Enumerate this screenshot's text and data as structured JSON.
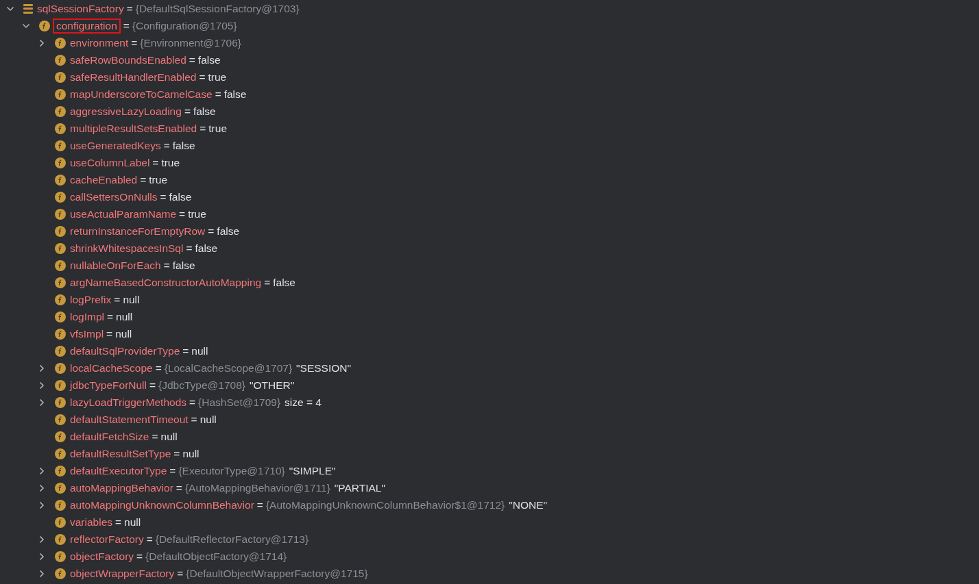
{
  "variables": [
    {
      "kind": "object",
      "name": "sqlSessionFactory",
      "eq": "=",
      "type": "{DefaultSqlSessionFactory@1703}",
      "expanded": true,
      "children": [
        {
          "kind": "field",
          "name": "configuration",
          "eq": "=",
          "type": "{Configuration@1705}",
          "expanded": true,
          "highlighted": true,
          "children": [
            {
              "kind": "field",
              "name": "environment",
              "eq": "=",
              "type": "{Environment@1706}",
              "expanded": false
            },
            {
              "kind": "field",
              "name": "safeRowBoundsEnabled",
              "eq": "=",
              "value": "false"
            },
            {
              "kind": "field",
              "name": "safeResultHandlerEnabled",
              "eq": "=",
              "value": "true"
            },
            {
              "kind": "field",
              "name": "mapUnderscoreToCamelCase",
              "eq": "=",
              "value": "false"
            },
            {
              "kind": "field",
              "name": "aggressiveLazyLoading",
              "eq": "=",
              "value": "false"
            },
            {
              "kind": "field",
              "name": "multipleResultSetsEnabled",
              "eq": "=",
              "value": "true"
            },
            {
              "kind": "field",
              "name": "useGeneratedKeys",
              "eq": "=",
              "value": "false"
            },
            {
              "kind": "field",
              "name": "useColumnLabel",
              "eq": "=",
              "value": "true"
            },
            {
              "kind": "field",
              "name": "cacheEnabled",
              "eq": "=",
              "value": "true"
            },
            {
              "kind": "field",
              "name": "callSettersOnNulls",
              "eq": "=",
              "value": "false"
            },
            {
              "kind": "field",
              "name": "useActualParamName",
              "eq": "=",
              "value": "true"
            },
            {
              "kind": "field",
              "name": "returnInstanceForEmptyRow",
              "eq": "=",
              "value": "false"
            },
            {
              "kind": "field",
              "name": "shrinkWhitespacesInSql",
              "eq": "=",
              "value": "false"
            },
            {
              "kind": "field",
              "name": "nullableOnForEach",
              "eq": "=",
              "value": "false"
            },
            {
              "kind": "field",
              "name": "argNameBasedConstructorAutoMapping",
              "eq": "=",
              "value": "false"
            },
            {
              "kind": "field",
              "name": "logPrefix",
              "eq": "=",
              "value": "null"
            },
            {
              "kind": "field",
              "name": "logImpl",
              "eq": "=",
              "value": "null"
            },
            {
              "kind": "field",
              "name": "vfsImpl",
              "eq": "=",
              "value": "null"
            },
            {
              "kind": "field",
              "name": "defaultSqlProviderType",
              "eq": "=",
              "value": "null"
            },
            {
              "kind": "field",
              "name": "localCacheScope",
              "eq": "=",
              "type": "{LocalCacheScope@1707}",
              "value": "\"SESSION\"",
              "expanded": false
            },
            {
              "kind": "field",
              "name": "jdbcTypeForNull",
              "eq": "=",
              "type": "{JdbcType@1708}",
              "value": "\"OTHER\"",
              "expanded": false
            },
            {
              "kind": "field",
              "name": "lazyLoadTriggerMethods",
              "eq": "=",
              "type": "{HashSet@1709}",
              "value": "size = 4",
              "expanded": false
            },
            {
              "kind": "field",
              "name": "defaultStatementTimeout",
              "eq": "=",
              "value": "null"
            },
            {
              "kind": "field",
              "name": "defaultFetchSize",
              "eq": "=",
              "value": "null"
            },
            {
              "kind": "field",
              "name": "defaultResultSetType",
              "eq": "=",
              "value": "null"
            },
            {
              "kind": "field",
              "name": "defaultExecutorType",
              "eq": "=",
              "type": "{ExecutorType@1710}",
              "value": "\"SIMPLE\"",
              "expanded": false
            },
            {
              "kind": "field",
              "name": "autoMappingBehavior",
              "eq": "=",
              "type": "{AutoMappingBehavior@1711}",
              "value": "\"PARTIAL\"",
              "expanded": false
            },
            {
              "kind": "field",
              "name": "autoMappingUnknownColumnBehavior",
              "eq": "=",
              "type": "{AutoMappingUnknownColumnBehavior$1@1712}",
              "value": "\"NONE\"",
              "expanded": false
            },
            {
              "kind": "field",
              "name": "variables",
              "eq": "=",
              "value": "null"
            },
            {
              "kind": "field",
              "name": "reflectorFactory",
              "eq": "=",
              "type": "{DefaultReflectorFactory@1713}",
              "expanded": false
            },
            {
              "kind": "field",
              "name": "objectFactory",
              "eq": "=",
              "type": "{DefaultObjectFactory@1714}",
              "expanded": false
            },
            {
              "kind": "field",
              "name": "objectWrapperFactory",
              "eq": "=",
              "type": "{DefaultObjectWrapperFactory@1715}",
              "expanded": false
            }
          ]
        }
      ]
    }
  ]
}
